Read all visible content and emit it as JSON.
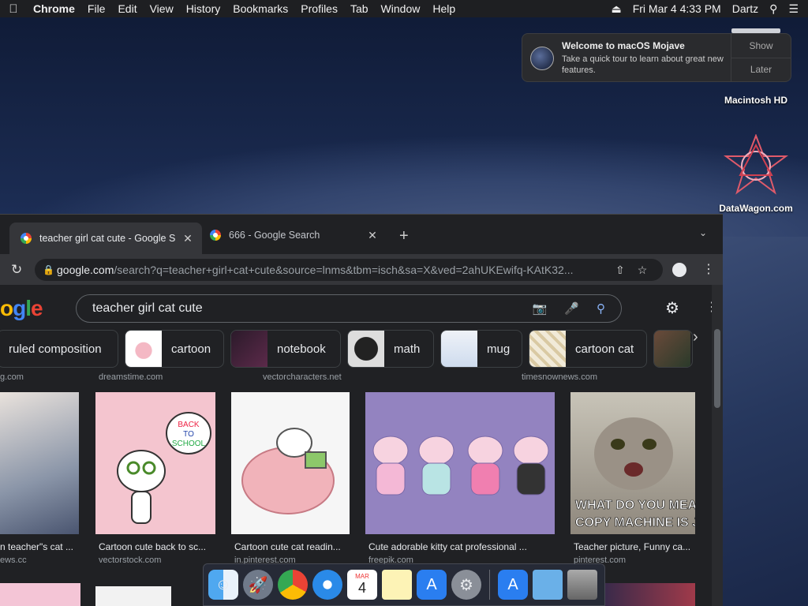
{
  "menubar": {
    "app": "Chrome",
    "items": [
      "File",
      "Edit",
      "View",
      "History",
      "Bookmarks",
      "Profiles",
      "Tab",
      "Window",
      "Help"
    ],
    "datetime": "Fri Mar 4  4:33 PM",
    "user": "Dartz"
  },
  "notification": {
    "title": "Welcome to macOS Mojave",
    "body": "Take a quick tour to learn about great new features.",
    "show": "Show",
    "later": "Later"
  },
  "desktop": {
    "hd_label": "Macintosh HD",
    "datawagon_label": "DataWagon.com"
  },
  "tabs": [
    {
      "title": "teacher girl cat cute - Google S"
    },
    {
      "title": "666 - Google Search"
    }
  ],
  "omnibox": {
    "domain": "google.com",
    "path": "/search?q=teacher+girl+cat+cute&source=lnms&tbm=isch&sa=X&ved=2ahUKEwifq-KAtK32..."
  },
  "search": {
    "logo": [
      "o",
      "g",
      "l",
      "e"
    ],
    "query": "teacher girl cat cute"
  },
  "chips": [
    "ruled composition",
    "cartoon",
    "notebook",
    "math",
    "mug",
    "cartoon cat"
  ],
  "top_sources": [
    "g.com",
    "dreamstime.com",
    "vectorcharacters.net",
    "timesnownews.com"
  ],
  "results": [
    {
      "caption": "n teacher\"s cat ...",
      "source": "ews.cc"
    },
    {
      "caption": "Cartoon cute back to sc...",
      "source": "vectorstock.com"
    },
    {
      "caption": "Cartoon cute cat readin...",
      "source": "in.pinterest.com"
    },
    {
      "caption": "Cute adorable kitty cat professional ...",
      "source": "freepik.com"
    },
    {
      "caption": "Teacher picture, Funny ca...",
      "source": "pinterest.com"
    }
  ],
  "image_text": {
    "back_to_school": [
      "BACK",
      "TO",
      "SCHOOL"
    ],
    "meme": [
      "WHAT DO YOU MEAN TH",
      "COPY MACHINE IS JAMM"
    ]
  },
  "dock": {
    "calendar_month": "MAR",
    "calendar_day": "4"
  },
  "colors": {
    "google_blue": "#4285f4",
    "google_red": "#ea4335",
    "google_yellow": "#fbbc05",
    "google_green": "#34a853",
    "chrome_dark": "#202124"
  }
}
